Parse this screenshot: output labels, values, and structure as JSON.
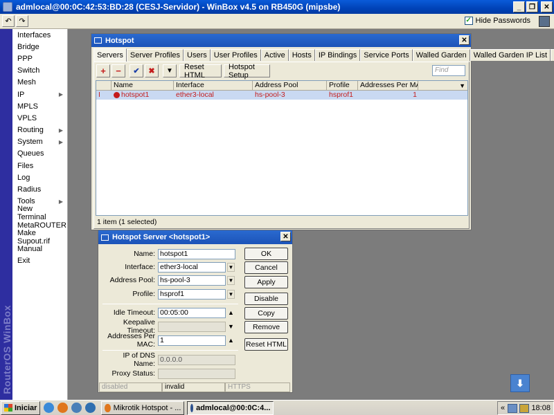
{
  "window": {
    "title": "admlocal@00:0C:42:53:BD:28 (CESJ-Servidor) - WinBox v4.5 on RB450G (mipsbe)",
    "min": "_",
    "restore": "❐",
    "close": "✕"
  },
  "toolbar": {
    "undo": "↶",
    "redo": "↷",
    "hide_passwords_label": "Hide Passwords",
    "hide_passwords_checked": "✓"
  },
  "side_band_text": "RouterOS WinBox",
  "menu": [
    {
      "label": "Interfaces",
      "arrow": ""
    },
    {
      "label": "Bridge",
      "arrow": ""
    },
    {
      "label": "PPP",
      "arrow": ""
    },
    {
      "label": "Switch",
      "arrow": ""
    },
    {
      "label": "Mesh",
      "arrow": ""
    },
    {
      "label": "IP",
      "arrow": "▶"
    },
    {
      "label": "MPLS",
      "arrow": ""
    },
    {
      "label": "VPLS",
      "arrow": ""
    },
    {
      "label": "Routing",
      "arrow": "▶"
    },
    {
      "label": "System",
      "arrow": "▶"
    },
    {
      "label": "Queues",
      "arrow": ""
    },
    {
      "label": "Files",
      "arrow": ""
    },
    {
      "label": "Log",
      "arrow": ""
    },
    {
      "label": "Radius",
      "arrow": ""
    },
    {
      "label": "Tools",
      "arrow": "▶"
    },
    {
      "label": "New Terminal",
      "arrow": ""
    },
    {
      "label": "MetaROUTER",
      "arrow": ""
    },
    {
      "label": "Make Supout.rif",
      "arrow": ""
    },
    {
      "label": "Manual",
      "arrow": ""
    },
    {
      "label": "Exit",
      "arrow": ""
    }
  ],
  "hotspot": {
    "title": "Hotspot",
    "close": "✕",
    "tabs": [
      "Servers",
      "Server Profiles",
      "Users",
      "User Profiles",
      "Active",
      "Hosts",
      "IP Bindings",
      "Service Ports",
      "Walled Garden",
      "Walled Garden IP List",
      "..."
    ],
    "actions": {
      "add": "+",
      "remove": "−",
      "enable": "✔",
      "disable": "✖",
      "filter": "▼",
      "reset_html": "Reset HTML",
      "hotspot_setup": "Hotspot Setup"
    },
    "find_placeholder": "Find",
    "columns": [
      "",
      "Name",
      "Interface",
      "Address Pool",
      "Profile",
      "Addresses Per MAC"
    ],
    "column_menu": "▼",
    "rows": [
      {
        "flag": "I",
        "name": "hotspot1",
        "interface": "ether3-local",
        "address_pool": "hs-pool-3",
        "profile": "hsprof1",
        "addresses_per_mac": "1"
      }
    ],
    "status": "1 item (1 selected)"
  },
  "dialog": {
    "title": "Hotspot Server <hotspot1>",
    "close": "✕",
    "fields": {
      "name": {
        "label": "Name:",
        "value": "hotspot1"
      },
      "interface": {
        "label": "Interface:",
        "value": "ether3-local"
      },
      "address_pool": {
        "label": "Address Pool:",
        "value": "hs-pool-3"
      },
      "profile": {
        "label": "Profile:",
        "value": "hsprof1"
      },
      "idle_timeout": {
        "label": "Idle Timeout:",
        "value": "00:05:00"
      },
      "keepalive_timeout": {
        "label": "Keepalive Timeout:",
        "value": ""
      },
      "addresses_per_mac": {
        "label": "Addresses Per MAC:",
        "value": "1"
      },
      "ip_of_dns_name": {
        "label": "IP of DNS Name:",
        "value": "0.0.0.0"
      },
      "proxy_status": {
        "label": "Proxy Status:",
        "value": ""
      }
    },
    "dropdown_arrow": "▼",
    "up_arrow": "▲",
    "buttons": {
      "ok": "OK",
      "cancel": "Cancel",
      "apply": "Apply",
      "disable": "Disable",
      "copy": "Copy",
      "remove": "Remove",
      "reset_html": "Reset HTML"
    },
    "status": [
      "disabled",
      "invalid",
      "HTTPS"
    ]
  },
  "taskbar": {
    "start_label": "Iniciar",
    "tasks": [
      {
        "label": "Mikrotik Hotspot - ...",
        "active": false
      },
      {
        "label": "admlocal@00:0C:4...",
        "active": true
      }
    ],
    "tray_chevron": "«",
    "clock": "18:08"
  },
  "download_icon": "⬇",
  "colors": {
    "title_blue": "#0a5bd9",
    "selected_row": "#c9d9f2",
    "row_text": "#c41c1c",
    "side_band": "#2e2ea0"
  }
}
